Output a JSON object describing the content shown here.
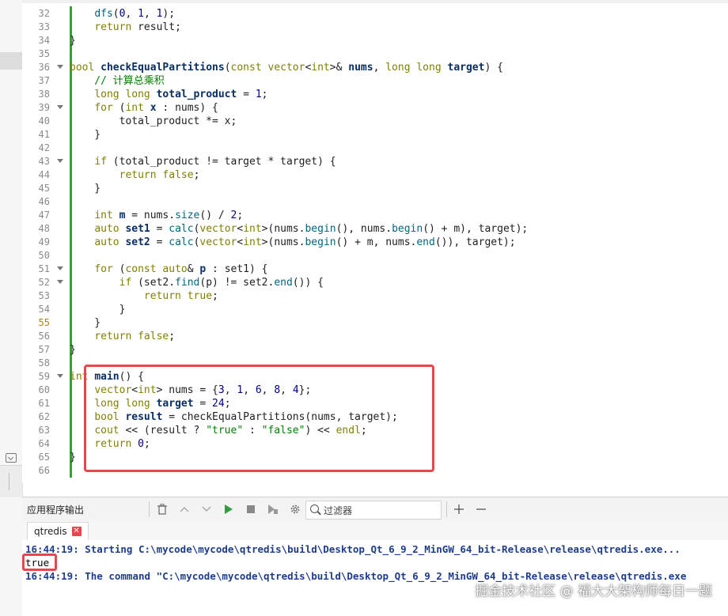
{
  "editor": {
    "lines": [
      {
        "n": "32",
        "code": "    dfs(0, 1, 1);"
      },
      {
        "n": "33",
        "code": "    return result;"
      },
      {
        "n": "34",
        "code": "}"
      },
      {
        "n": "35",
        "code": ""
      },
      {
        "n": "36",
        "code": "bool checkEqualPartitions(const vector<int>& nums, long long target) {"
      },
      {
        "n": "37",
        "code": "    // 计算总乘积"
      },
      {
        "n": "38",
        "code": "    long long total_product = 1;"
      },
      {
        "n": "39",
        "code": "    for (int x : nums) {"
      },
      {
        "n": "40",
        "code": "        total_product *= x;"
      },
      {
        "n": "41",
        "code": "    }"
      },
      {
        "n": "42",
        "code": ""
      },
      {
        "n": "43",
        "code": "    if (total_product != target * target) {"
      },
      {
        "n": "44",
        "code": "        return false;"
      },
      {
        "n": "45",
        "code": "    }"
      },
      {
        "n": "46",
        "code": ""
      },
      {
        "n": "47",
        "code": "    int m = nums.size() / 2;"
      },
      {
        "n": "48",
        "code": "    auto set1 = calc(vector<int>(nums.begin(), nums.begin() + m), target);"
      },
      {
        "n": "49",
        "code": "    auto set2 = calc(vector<int>(nums.begin() + m, nums.end()), target);"
      },
      {
        "n": "50",
        "code": ""
      },
      {
        "n": "51",
        "code": "    for (const auto& p : set1) {"
      },
      {
        "n": "52",
        "code": "        if (set2.find(p) != set2.end()) {"
      },
      {
        "n": "53",
        "code": "            return true;"
      },
      {
        "n": "54",
        "code": "        }"
      },
      {
        "n": "55",
        "code": "    }"
      },
      {
        "n": "56",
        "code": "    return false;"
      },
      {
        "n": "57",
        "code": "}"
      },
      {
        "n": "58",
        "code": ""
      },
      {
        "n": "59",
        "code": "int main() {"
      },
      {
        "n": "60",
        "code": "    vector<int> nums = {3, 1, 6, 8, 4};"
      },
      {
        "n": "61",
        "code": "    long long target = 24;"
      },
      {
        "n": "62",
        "code": "    bool result = checkEqualPartitions(nums, target);"
      },
      {
        "n": "63",
        "code": "    cout << (result ? \"true\" : \"false\") << endl;"
      },
      {
        "n": "64",
        "code": "    return 0;"
      },
      {
        "n": "65",
        "code": "}"
      },
      {
        "n": "66",
        "code": ""
      }
    ],
    "active_line": "55",
    "fold_lines": [
      "36",
      "39",
      "43",
      "51",
      "52",
      "59"
    ]
  },
  "output_pane": {
    "title": "应用程序输出",
    "filter_placeholder": "过滤器",
    "tab_label": "qtredis",
    "lines": [
      "16:44:19: Starting C:\\mycode\\mycode\\qtredis\\build\\Desktop_Qt_6_9_2_MinGW_64_bit-Release\\release\\qtredis.exe...",
      "true",
      "16:44:19: The command \"C:\\mycode\\mycode\\qtredis\\build\\Desktop_Qt_6_9_2_MinGW_64_bit-Release\\release\\qtredis.exe"
    ]
  },
  "watermark": "掘金技术社区 @ 福大大架构师每日一题",
  "colors": {
    "highlight": "#e8454d",
    "change_bar": "#3a9d3a",
    "keyword": "#808000",
    "output_info": "#1d3c8c"
  }
}
